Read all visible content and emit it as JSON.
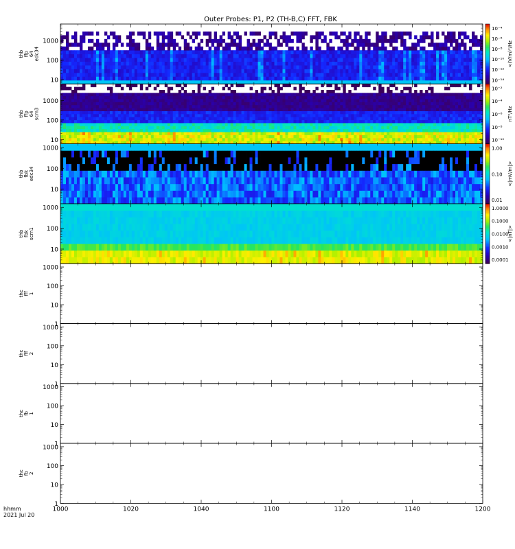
{
  "title": "Outer Probes: P1, P2 (TH-B,C) FFT, FBK",
  "time_label_line1": "hhmm",
  "time_label_line2": "2021 Jul 20",
  "chart_data": {
    "type": "heatmap",
    "title": "Outer Probes: P1, P2 (TH-B,C) FFT, FBK",
    "x_ticks": [
      "1000",
      "1020",
      "1040",
      "1100",
      "1120",
      "1140",
      "1200"
    ],
    "x_range_minutes": [
      0,
      120
    ],
    "panels": [
      {
        "ylabel": [
          "thb",
          "ffp",
          "64",
          "edc34"
        ],
        "yticks": [
          "10",
          "100",
          "1000"
        ],
        "ylim": [
          6,
          7000
        ],
        "has_data": true,
        "colormap": "edc",
        "colorbar": {
          "ticks": [
            "10⁻⁴",
            "10⁻⁶",
            "10⁻⁸",
            "10⁻¹⁰",
            "10⁻¹²",
            "10⁻¹⁴"
          ],
          "label": "<(V/m)²/Hz"
        }
      },
      {
        "ylabel": [
          "thb",
          "ffp",
          "64",
          "scm3"
        ],
        "yticks": [
          "10",
          "100",
          "1000"
        ],
        "ylim": [
          6,
          7000
        ],
        "has_data": true,
        "colormap": "scm",
        "colorbar": {
          "ticks": [
            "10⁻²",
            "10⁻⁴",
            "10⁻⁶",
            "10⁻⁸",
            "10⁻¹⁰"
          ],
          "label": "nT²/Hz"
        }
      },
      {
        "ylabel": [
          "thb",
          "fbk",
          "edc34"
        ],
        "yticks": [
          "10",
          "100",
          "1000"
        ],
        "ylim": [
          2,
          1500
        ],
        "has_data": true,
        "colormap": "fbk_e",
        "colorbar": {
          "ticks": [
            "1.00",
            "0.10",
            "0.01"
          ],
          "label": "<|mV/m|>"
        }
      },
      {
        "ylabel": [
          "thb",
          "fbk",
          "scm1"
        ],
        "yticks": [
          "10",
          "100",
          "1000"
        ],
        "ylim": [
          2,
          1500
        ],
        "has_data": true,
        "colormap": "fbk_b",
        "colorbar": {
          "ticks": [
            "1.0000",
            "0.1000",
            "0.0100",
            "0.0010",
            "0.0001"
          ],
          "label": "<|nT|>"
        }
      },
      {
        "ylabel": [
          "thc",
          "fff",
          "1"
        ],
        "yticks": [
          "1",
          "10",
          "100",
          "1000"
        ],
        "ylim": [
          1,
          1500
        ],
        "has_data": false
      },
      {
        "ylabel": [
          "thc",
          "fff",
          "2"
        ],
        "yticks": [
          "1",
          "10",
          "100",
          "1000"
        ],
        "ylim": [
          1,
          1500
        ],
        "has_data": false
      },
      {
        "ylabel": [
          "thc",
          "fb",
          "1"
        ],
        "yticks": [
          "1",
          "10",
          "100",
          "1000"
        ],
        "ylim": [
          1,
          1500
        ],
        "has_data": false
      },
      {
        "ylabel": [
          "thc",
          "fb",
          "2"
        ],
        "yticks": [
          "1",
          "10",
          "100",
          "1000"
        ],
        "ylim": [
          1,
          1500
        ],
        "has_data": false
      }
    ]
  }
}
